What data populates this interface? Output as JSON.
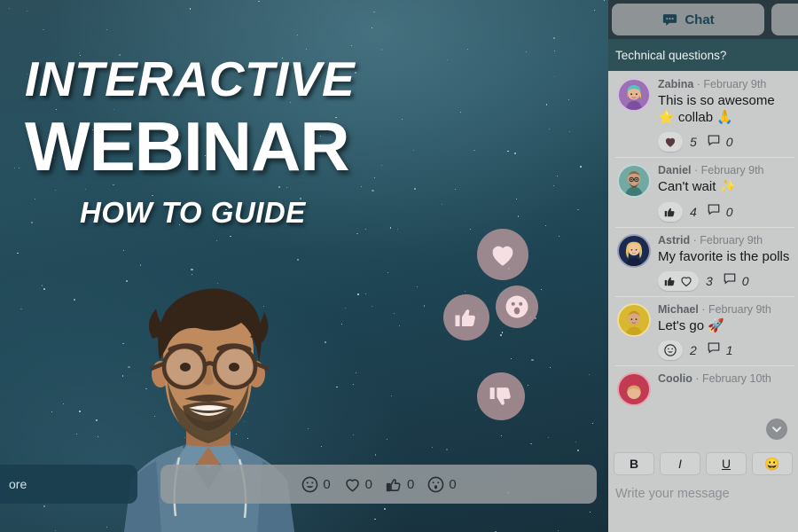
{
  "video": {
    "title_line1": "INTERACTIVE",
    "title_line2": "WEBINAR",
    "title_line3": "HOW TO GUIDE",
    "presenter_alt": "presenter-portrait",
    "background": "starry-night-sky",
    "colors": {
      "sky_top": "#2d4f5c",
      "sky_bottom": "#17303c",
      "bubble": "#ba989c"
    },
    "floating_reactions": [
      {
        "name": "heart",
        "icon": "heart-icon"
      },
      {
        "name": "thumbs-up",
        "icon": "thumbs-up-icon"
      },
      {
        "name": "wow",
        "icon": "surprised-face-icon"
      },
      {
        "name": "thumbs-down",
        "icon": "thumbs-down-icon"
      }
    ]
  },
  "more_bar": {
    "label": "ore"
  },
  "reaction_bar": {
    "items": [
      {
        "icon": "smiley-icon",
        "count": "0"
      },
      {
        "icon": "heart-outline-icon",
        "count": "0"
      },
      {
        "icon": "thumbs-up-icon",
        "count": "0"
      },
      {
        "icon": "surprised-face-icon",
        "count": "0"
      }
    ]
  },
  "chat": {
    "tabs": [
      {
        "label": "Chat",
        "icon": "chat-bubble-icon",
        "active": true
      },
      {
        "label": "",
        "icon": "",
        "active": false
      }
    ],
    "banner": "Technical questions?",
    "messages": [
      {
        "author": "Zabina",
        "date": "February 9th",
        "text": "This is so awesome ⭐ collab 🙏",
        "avatar_color": "#9d6fb5",
        "reactions": [
          {
            "icon": "heart-icon",
            "count": "5"
          }
        ],
        "comments": "0"
      },
      {
        "author": "Daniel",
        "date": "February 9th",
        "text": "Can't wait ✨",
        "avatar_color": "#74a9a3",
        "reactions": [
          {
            "icon": "thumbs-up-icon",
            "count": "4"
          }
        ],
        "comments": "0"
      },
      {
        "author": "Astrid",
        "date": "February 9th",
        "text": "My favorite is the polls",
        "avatar_color": "#1b2a52",
        "reactions": [
          {
            "icon": "thumbs-up-icon",
            "count": ""
          },
          {
            "icon": "heart-outline-icon",
            "count": "3"
          }
        ],
        "comments": "0"
      },
      {
        "author": "Michael",
        "date": "February 9th",
        "text": "Let's go 🚀",
        "avatar_color": "#d9b72e",
        "reactions": [
          {
            "icon": "smiley-icon",
            "count": "2"
          }
        ],
        "comments": "1"
      },
      {
        "author": "Coolio",
        "date": "February 10th",
        "text": "",
        "avatar_color": "#c23b52",
        "reactions": [],
        "comments": ""
      }
    ],
    "scroll_icon": "chevron-down-icon",
    "composer": {
      "bold": "B",
      "italic": "I",
      "underline": "U",
      "emoji": "😀",
      "placeholder": "Write your message"
    }
  }
}
